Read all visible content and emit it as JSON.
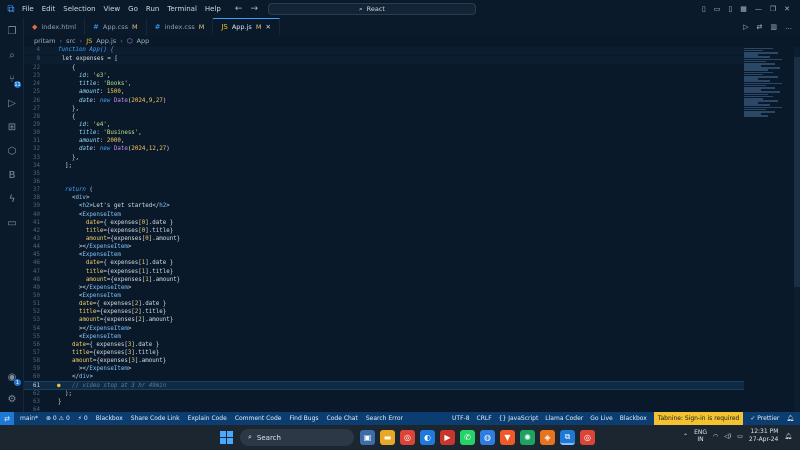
{
  "titlebar": {
    "menu": [
      "File",
      "Edit",
      "Selection",
      "View",
      "Go",
      "Run",
      "Terminal",
      "Help"
    ],
    "search_text": "React"
  },
  "tabs": [
    {
      "label": "index.html",
      "modified": "",
      "icon": "html-file-icon"
    },
    {
      "label": "App.css",
      "modified": "M",
      "icon": "css-file-icon"
    },
    {
      "label": "index.css",
      "modified": "M",
      "icon": "css-file-icon"
    },
    {
      "label": "App.js",
      "modified": "M",
      "icon": "js-file-icon",
      "active": true
    }
  ],
  "breadcrumb": [
    "pritam",
    "src",
    "App.js",
    "App"
  ],
  "sticky_lines": [
    {
      "n": "4",
      "text": "function App() {"
    },
    {
      "n": "9",
      "text": "let expenses = ["
    }
  ],
  "code_lines": [
    {
      "n": "22",
      "text": "    {"
    },
    {
      "n": "23",
      "text": "      id: 'e3',"
    },
    {
      "n": "24",
      "text": "      title: 'Books',"
    },
    {
      "n": "25",
      "text": "      amount: 1500,"
    },
    {
      "n": "26",
      "text": "      date: new Date(2024,9,27)"
    },
    {
      "n": "27",
      "text": "    },"
    },
    {
      "n": "28",
      "text": "    {"
    },
    {
      "n": "29",
      "text": "      id: 'e4',"
    },
    {
      "n": "30",
      "text": "      title: 'Business',"
    },
    {
      "n": "31",
      "text": "      amount: 2000,"
    },
    {
      "n": "32",
      "text": "      date: new Date(2024,12,27)"
    },
    {
      "n": "33",
      "text": "    },"
    },
    {
      "n": "34",
      "text": "  ];"
    },
    {
      "n": "35",
      "text": ""
    },
    {
      "n": "36",
      "text": ""
    },
    {
      "n": "37",
      "text": "  return ("
    },
    {
      "n": "38",
      "text": "    <div>"
    },
    {
      "n": "39",
      "text": "      <h2>Let's get started</h2>"
    },
    {
      "n": "40",
      "text": "      <ExpenseItem"
    },
    {
      "n": "41",
      "text": "        date={ expenses[0].date }"
    },
    {
      "n": "42",
      "text": "        title={expenses[0].title}"
    },
    {
      "n": "43",
      "text": "        amount={expenses[0].amount}"
    },
    {
      "n": "44",
      "text": "      ></ExpenseItem>"
    },
    {
      "n": "45",
      "text": "      <ExpenseItem"
    },
    {
      "n": "46",
      "text": "        date={ expenses[1].date }"
    },
    {
      "n": "47",
      "text": "        title={expenses[1].title}"
    },
    {
      "n": "48",
      "text": "        amount={expenses[1].amount}"
    },
    {
      "n": "49",
      "text": "      ></ExpenseItem>"
    },
    {
      "n": "50",
      "text": "      <ExpenseItem"
    },
    {
      "n": "51",
      "text": "      date={ expenses[2].date }"
    },
    {
      "n": "52",
      "text": "      title={expenses[2].title}"
    },
    {
      "n": "53",
      "text": "      amount={expenses[2].amount}"
    },
    {
      "n": "54",
      "text": "      ></ExpenseItem>"
    },
    {
      "n": "55",
      "text": "      <ExpenseItem"
    },
    {
      "n": "56",
      "text": "    date={ expenses[3].date }"
    },
    {
      "n": "57",
      "text": "    title={expenses[3].title}"
    },
    {
      "n": "58",
      "text": "    amount={expenses[3].amount}"
    },
    {
      "n": "59",
      "text": "      ></ExpenseItem>"
    },
    {
      "n": "60",
      "text": "    </div>"
    },
    {
      "n": "61",
      "text": "    // video stop at 3 hr 49min"
    },
    {
      "n": "62",
      "text": "  );"
    },
    {
      "n": "63",
      "text": "}"
    },
    {
      "n": "64",
      "text": ""
    },
    {
      "n": "65",
      "text": "export default App;"
    }
  ],
  "status": {
    "left": [
      "main*",
      "⊗ 0 ⚠ 0",
      "⚡ 0",
      "Blackbox",
      "Share Code Link",
      "Explain Code",
      "Comment Code",
      "Find Bugs",
      "Code Chat",
      "Search Error"
    ],
    "right": [
      "UTF-8",
      "CRLF",
      "{} JavaScript",
      "Llama Coder",
      "Go Live",
      "Blackbox"
    ],
    "tabnine": "Tabnine: Sign-in is required",
    "prettier": "✓ Prettier"
  },
  "taskbar": {
    "search": "Search",
    "lang_top": "ENG",
    "lang_bottom": "IN",
    "time": "12:31 PM",
    "date": "27-Apr-24"
  }
}
